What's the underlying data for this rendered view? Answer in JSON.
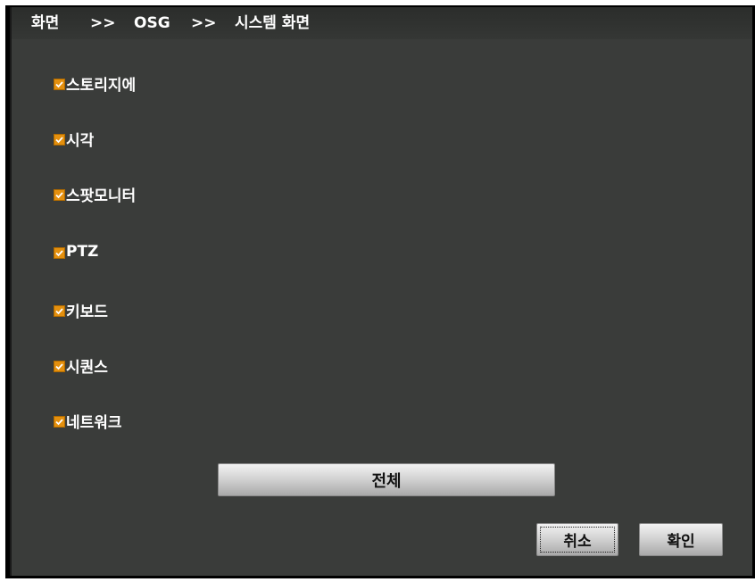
{
  "breadcrumb": {
    "part1": "화면",
    "sep1": ">>",
    "part2": "OSG",
    "sep2": ">>",
    "part3": "시스템 화면"
  },
  "options": [
    {
      "label": "스토리지에",
      "checked": true
    },
    {
      "label": "시각",
      "checked": true
    },
    {
      "label": "스팟모니터",
      "checked": true
    },
    {
      "label": "PTZ",
      "checked": true
    },
    {
      "label": "키보드",
      "checked": true
    },
    {
      "label": "시퀀스",
      "checked": true
    },
    {
      "label": "네트워크",
      "checked": true
    }
  ],
  "buttons": {
    "all": "전체",
    "cancel": "취소",
    "confirm": "확인"
  },
  "colors": {
    "panel": "#3a3c3a",
    "checkbox": "#e4900e"
  }
}
